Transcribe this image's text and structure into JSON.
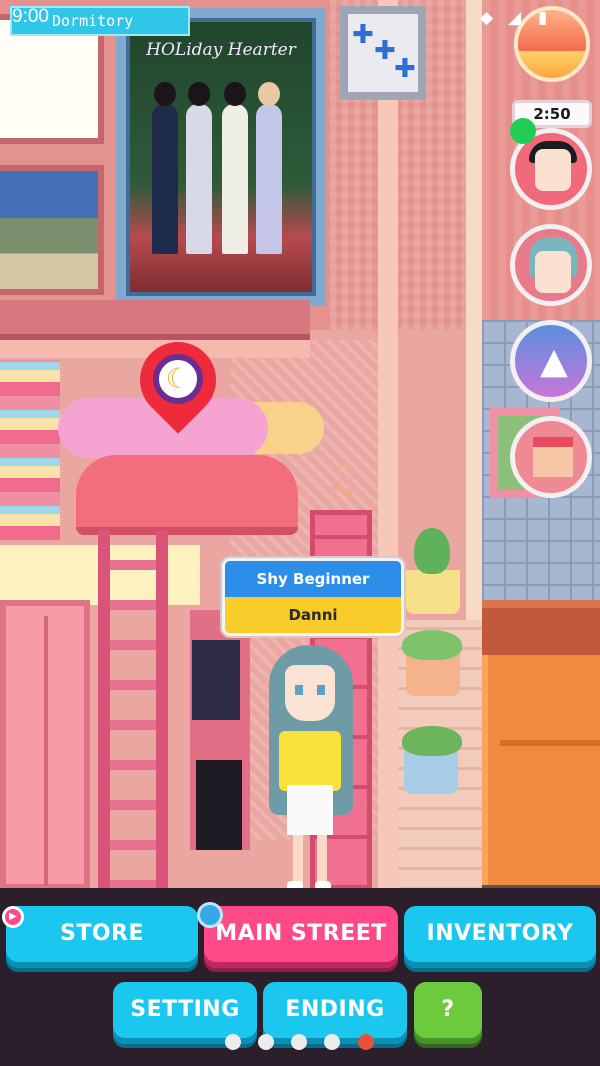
{
  "status_bar": {
    "time": "9:00",
    "location": "Dormitory",
    "wifi_icon": "wifi-icon",
    "signal_icon": "signal-icon",
    "battery_icon": "battery-icon"
  },
  "poster": {
    "title": "HOLiday Hearter"
  },
  "map_pin": {
    "icon": "moon-icon"
  },
  "nametag": {
    "title": "Shy Beginner",
    "name": "Danni"
  },
  "right_menu": {
    "timer": "2:50",
    "items": [
      {
        "name": "time-of-day",
        "icon": "sun-icon"
      },
      {
        "name": "boy-character",
        "icon": "boy-avatar-icon"
      },
      {
        "name": "girl-character",
        "icon": "girl-avatar-icon"
      },
      {
        "name": "wardrobe",
        "icon": "dress-icon"
      },
      {
        "name": "shop",
        "icon": "shop-icon"
      }
    ]
  },
  "buttons": {
    "store": "STORE",
    "main_street": "MAIN STREET",
    "inventory": "INVENTORY",
    "setting": "SETTING",
    "ending": "ENDING",
    "help": "?"
  },
  "pagination": {
    "count": 5,
    "active_index": 4
  },
  "colors": {
    "button_blue": "#1bc7ee",
    "button_pink": "#ff4a87",
    "button_green": "#6ccb3c",
    "nametag_blue": "#2c8ee8",
    "nametag_yellow": "#f8cc2b"
  }
}
